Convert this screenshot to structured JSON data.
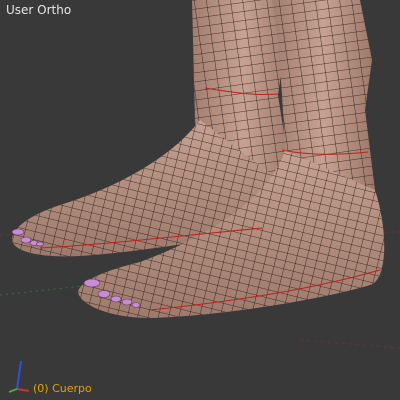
{
  "viewport": {
    "view_label": "User Ortho",
    "object_label": "(0) Cuerpo",
    "background": "#393939",
    "mesh": {
      "skin_color": "#c39b8b",
      "shadow_color": "#8c6a5e",
      "wire_color": "#1e1410",
      "seam_color": "#c02020",
      "nail_color": "#c98ad6"
    },
    "grid": {
      "x_axis_color": "#8a3030",
      "y_axis_color": "#3f7a3f"
    },
    "gizmo": {
      "x_color": "#d03030",
      "y_color": "#40b040",
      "z_color": "#3050e0"
    }
  }
}
